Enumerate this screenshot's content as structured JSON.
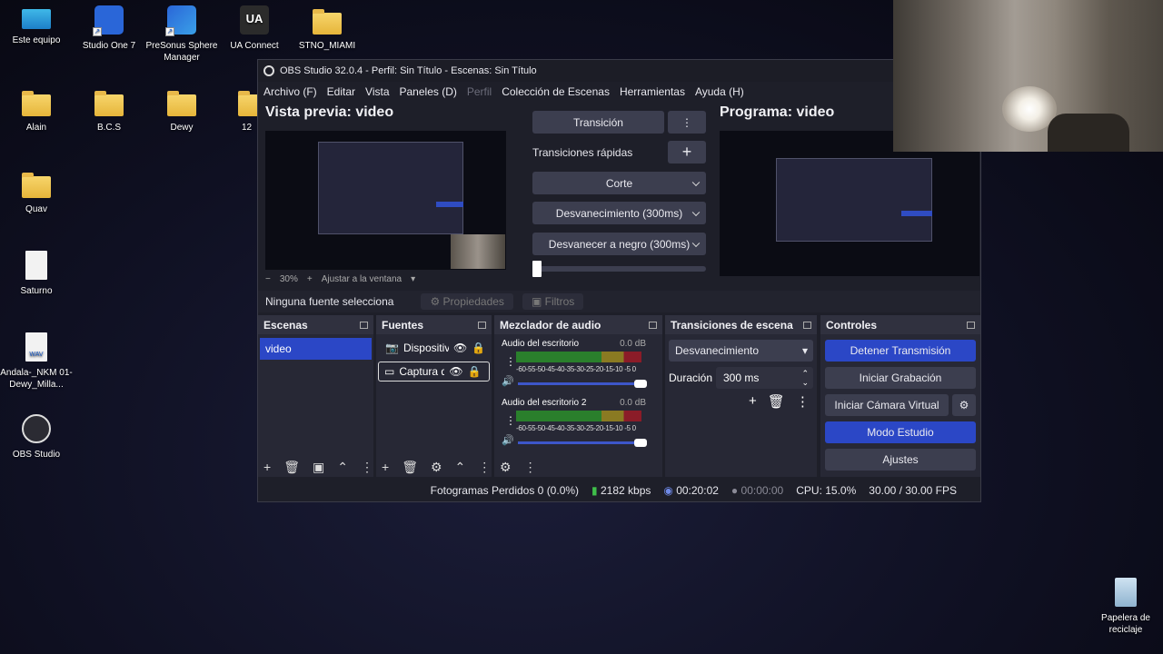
{
  "desktop": {
    "icons": [
      {
        "label": "Este equipo"
      },
      {
        "label": "Studio One 7"
      },
      {
        "label": "PreSonus Sphere Manager"
      },
      {
        "label": "UA Connect"
      },
      {
        "label": "STNO_MIAMI"
      },
      {
        "label": "Alain"
      },
      {
        "label": "B.C.S"
      },
      {
        "label": "Dewy"
      },
      {
        "label": "12"
      },
      {
        "label": "Quav"
      },
      {
        "label": "Saturno"
      },
      {
        "label": "Andala-_NKM 01-Dewy_Milla..."
      },
      {
        "label": "OBS Studio"
      },
      {
        "label": "Papelera de reciclaje"
      }
    ],
    "ua_glyph": "UA",
    "wav_glyph": "WAV"
  },
  "obs": {
    "title": "OBS Studio 32.0.4 - Perfil: Sin Título - Escenas: Sin Título",
    "menu": [
      "Archivo (F)",
      "Editar",
      "Vista",
      "Paneles (D)",
      "Perfil",
      "Colección de Escenas",
      "Herramientas",
      "Ayuda (H)"
    ],
    "preview_title": "Vista previa: video",
    "program_title": "Programa: video",
    "zoom": {
      "minus": "−",
      "value": "30%",
      "plus": "+",
      "fit": "Ajustar a la ventana"
    },
    "transition_button": "Transición",
    "quick_transitions_label": "Transiciones rápidas",
    "quick_transitions": [
      "Corte",
      "Desvanecimiento (300ms)",
      "Desvanecer a negro (300ms)"
    ],
    "t_bar_level": 0,
    "source_bar": {
      "text": "Ninguna fuente selecciona",
      "properties": "Propiedades",
      "filters": "Filtros"
    },
    "docks": {
      "scenes": {
        "title": "Escenas",
        "items": [
          "video"
        ]
      },
      "sources": {
        "title": "Fuentes",
        "items": [
          "Dispositiv",
          "Captura d"
        ]
      },
      "mixer": {
        "title": "Mezclador de audio",
        "channels": [
          {
            "name": "Audio del escritorio",
            "db": "0.0 dB"
          },
          {
            "name": "Audio del escritorio 2",
            "db": "0.0 dB"
          }
        ],
        "ticks": "-60-55-50-45-40-35-30-25-20-15-10 -5  0"
      },
      "transitions": {
        "title": "Transiciones de escena",
        "selected": "Desvanecimiento",
        "duration_label": "Duración",
        "duration_value": "300 ms"
      },
      "controls": {
        "title": "Controles",
        "buttons": [
          "Detener Transmisión",
          "Iniciar Grabación",
          "Iniciar Cámara Virtual",
          "Modo Estudio",
          "Ajustes"
        ]
      }
    },
    "status": {
      "dropped": "Fotogramas Perdidos 0 (0.0%)",
      "bitrate": "2182 kbps",
      "stream_time": "00:20:02",
      "rec_time": "00:00:00",
      "cpu": "CPU: 15.0%",
      "fps": "30.00 / 30.00 FPS"
    },
    "colors": {
      "accent": "#2b47c6",
      "panel": "#272835",
      "background": "#1e1f29"
    }
  }
}
